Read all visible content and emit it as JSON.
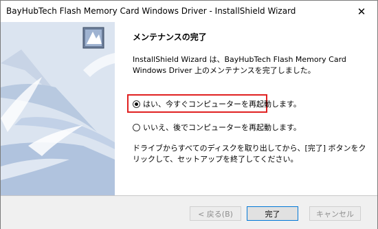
{
  "window": {
    "title": "BayHubTech Flash Memory Card Windows Driver - InstallShield Wizard",
    "close_glyph": "✕"
  },
  "content": {
    "heading": "メンテナンスの完了",
    "description": "InstallShield Wizard は、BayHubTech Flash Memory Card Windows Driver 上のメンテナンスを完了しました。",
    "option_yes": "はい、今すぐコンピューターを再起動します。",
    "option_no": "いいえ、後でコンピューターを再起動します。",
    "selected_option": "yes",
    "note": "ドライブからすべてのディスクを取り出してから、[完了] ボタンをクリックして、セットアップを終了してください。"
  },
  "buttons": {
    "back": "< 戻る(B)",
    "finish": "完了",
    "cancel": "キャンセル"
  },
  "colors": {
    "highlight": "#e02020",
    "panel_bg": "#dbe4f0"
  },
  "icons": {
    "close": "close-icon",
    "installer": "installer-icon"
  }
}
